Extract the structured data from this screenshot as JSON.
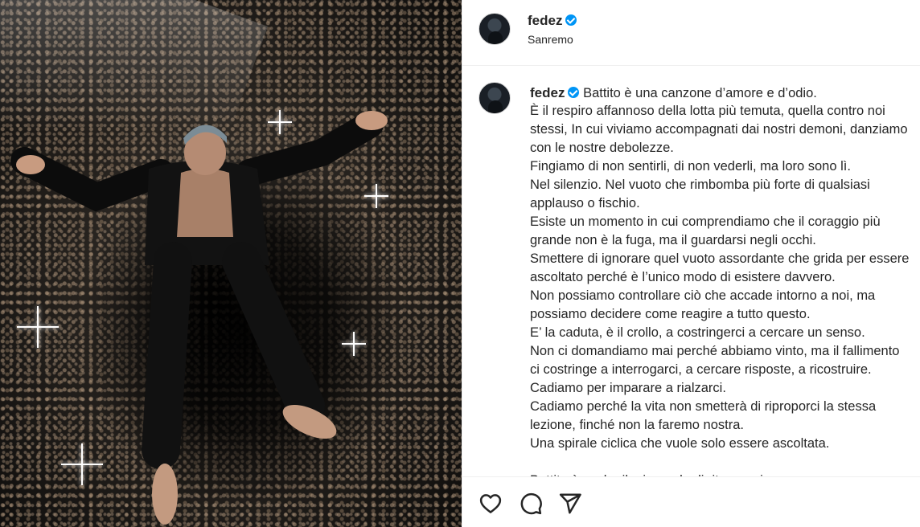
{
  "post": {
    "username": "fedez",
    "location": "Sanremo",
    "verified": true
  },
  "caption": {
    "username": "fedez",
    "first_line": "Battito è una canzone d’amore e d’odio.",
    "lines": [
      "È il respiro affannoso della lotta più temuta, quella contro noi",
      "stessi, In cui viviamo accompagnati dai nostri demoni, danziamo",
      "con le nostre debolezze.",
      "Fingiamo di non sentirli, di non vederli, ma loro sono lì.",
      "Nel silenzio. Nel vuoto che rimbomba più forte di qualsiasi",
      "applauso o fischio.",
      "Esiste un momento in cui comprendiamo che il coraggio più",
      "grande non è la fuga, ma il guardarsi negli occhi.",
      "Smettere di ignorare quel vuoto assordante che grida per essere",
      "ascoltato perché è l’unico modo di esistere davvero.",
      "Non possiamo controllare ciò che accade intorno a noi, ma",
      "possiamo decidere come reagire a tutto questo.",
      "E’ la caduta, è il crollo, a costringerci a cercare un senso.",
      "Non ci domandiamo mai perché abbiamo vinto, ma il fallimento",
      "ci costringe a interrogarci, a cercare risposte, a ricostruire.",
      "Cadiamo per imparare a rialzarci.",
      "Cadiamo perché la vita non smetterà di riproporci la stessa",
      "lezione, finché non la faremo nostra.",
      "Una spirale ciclica che vuole solo essere ascoltata.",
      "",
      "Battito è anche il mio modo di ritrovarmi."
    ]
  },
  "actions": {
    "icons": [
      "heart-icon",
      "comment-icon",
      "share-icon"
    ]
  },
  "colors": {
    "verified": "#0095f6",
    "text": "#262626",
    "divider": "#efefef"
  }
}
